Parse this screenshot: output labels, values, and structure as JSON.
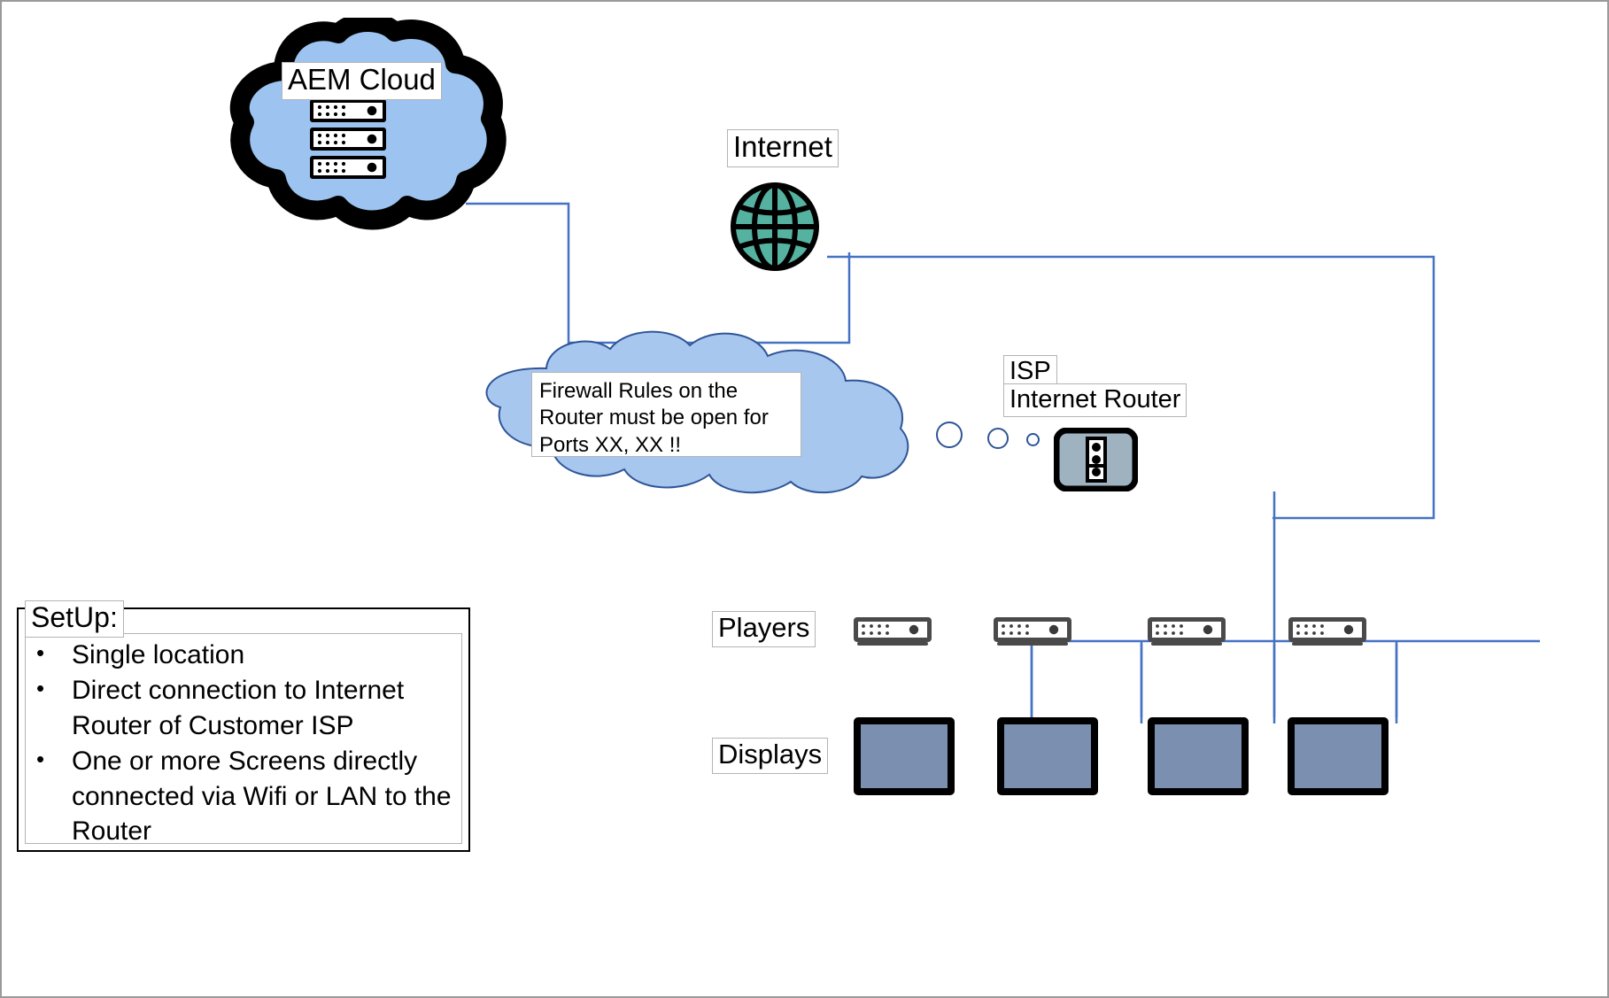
{
  "diagram": {
    "title": "AEM Cloud single-location network setup",
    "colors": {
      "cloud_fill": "#9dc3f0",
      "cloud_outline": "#000000",
      "globe_fill": "#55b2a0",
      "globe_outline": "#000000",
      "wire": "#4472c4",
      "router_fill": "#9fb2c0",
      "display_fill": "#7b8fb0",
      "player_body": "#4a4a4a",
      "label_border": "#b4b4b4",
      "page_border": "#9a9a9a"
    }
  },
  "aem_cloud": {
    "label": "AEM Cloud",
    "icon": "server-stack-icon"
  },
  "internet": {
    "label": "Internet",
    "icon": "globe-icon"
  },
  "thought_bubble": {
    "text": "Firewall Rules on the Router must be open for Ports XX, XX !!",
    "tail_circles": 3
  },
  "isp_router": {
    "label_top": "ISP",
    "label_bottom": "Internet Router",
    "icon": "router-icon"
  },
  "players": {
    "label": "Players",
    "count": 4,
    "items": [
      {
        "name": "player-1",
        "icon": "media-player-icon"
      },
      {
        "name": "player-2",
        "icon": "media-player-icon"
      },
      {
        "name": "player-3",
        "icon": "media-player-icon"
      },
      {
        "name": "player-4",
        "icon": "media-player-icon"
      }
    ]
  },
  "displays": {
    "label": "Displays",
    "count": 4,
    "items": [
      {
        "name": "display-1",
        "icon": "screen-icon"
      },
      {
        "name": "display-2",
        "icon": "screen-icon"
      },
      {
        "name": "display-3",
        "icon": "screen-icon"
      },
      {
        "name": "display-4",
        "icon": "screen-icon"
      }
    ]
  },
  "setup": {
    "title": "SetUp:",
    "bullets": [
      "Single location",
      "Direct connection to Internet Router of Customer ISP",
      "One or more Screens directly connected via Wifi or LAN to the Router"
    ]
  }
}
